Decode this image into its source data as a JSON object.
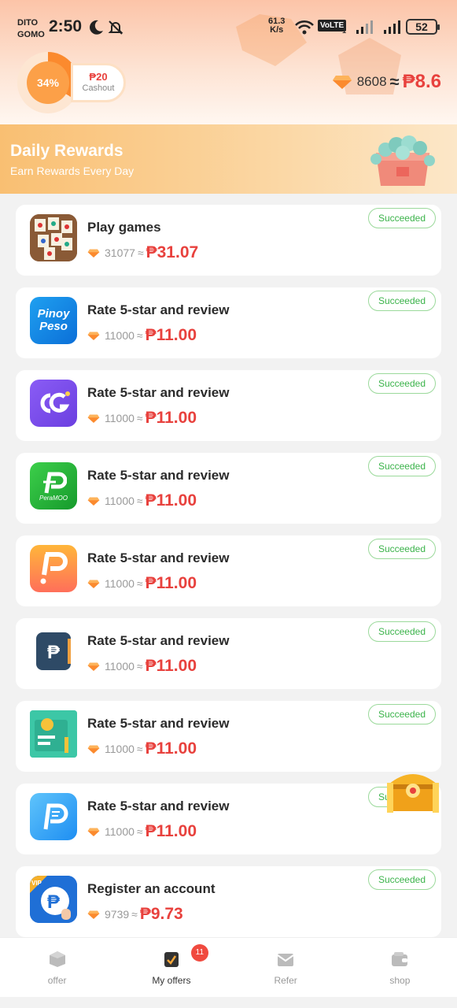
{
  "status_bar": {
    "carrier_line1": "DITO",
    "carrier_line2": "GOMO",
    "time": "2:50",
    "speed_value": "61.3",
    "speed_unit": "K/s",
    "volte": "VoLTE",
    "sim": "1",
    "battery": "52"
  },
  "header": {
    "progress_percent_text": "34%",
    "progress_fraction": 0.34,
    "cashout_amount": "₱20",
    "cashout_label": "Cashout",
    "coin_balance": "8608",
    "approx": "≈",
    "peso_balance": "₱8.6"
  },
  "banner": {
    "title": "Daily Rewards",
    "subtitle": "Earn Rewards Every Day"
  },
  "offers": [
    {
      "title": "Play games",
      "points": "31077",
      "approx": "≈",
      "cash": "₱31.07",
      "status": "Succeeded",
      "icon": "mahjong-game-icon"
    },
    {
      "title": "Rate 5-star and review",
      "points": "11000",
      "approx": "≈",
      "cash": "₱11.00",
      "status": "Succeeded",
      "icon": "pinoy-peso-icon",
      "icon_text": "Pinoy Peso"
    },
    {
      "title": "Rate 5-star and review",
      "points": "11000",
      "approx": "≈",
      "cash": "₱11.00",
      "status": "Succeeded",
      "icon": "cg-app-icon"
    },
    {
      "title": "Rate 5-star and review",
      "points": "11000",
      "approx": "≈",
      "cash": "₱11.00",
      "status": "Succeeded",
      "icon": "peramoo-icon",
      "icon_text": "PeraMOO"
    },
    {
      "title": "Rate 5-star and review",
      "points": "11000",
      "approx": "≈",
      "cash": "₱11.00",
      "status": "Succeeded",
      "icon": "orange-p-app-icon"
    },
    {
      "title": "Rate 5-star and review",
      "points": "11000",
      "approx": "≈",
      "cash": "₱11.00",
      "status": "Succeeded",
      "icon": "peso-wallet-icon"
    },
    {
      "title": "Rate 5-star and review",
      "points": "11000",
      "approx": "≈",
      "cash": "₱11.00",
      "status": "Succeeded",
      "icon": "green-card-app-icon"
    },
    {
      "title": "Rate 5-star and review",
      "points": "11000",
      "approx": "≈",
      "cash": "₱11.00",
      "status": "Succeeded",
      "icon": "blue-p-app-icon"
    },
    {
      "title": "Register an account",
      "points": "9739",
      "approx": "≈",
      "cash": "₱9.73",
      "status": "Succeeded",
      "icon": "vip-peso-icon"
    }
  ],
  "bottom_nav": {
    "items": [
      {
        "label": "offer",
        "icon": "box-icon"
      },
      {
        "label": "My offers",
        "icon": "clipboard-check-icon",
        "badge": "11"
      },
      {
        "label": "Refer",
        "icon": "envelope-icon"
      },
      {
        "label": "shop",
        "icon": "wallet-icon"
      }
    ]
  },
  "colors": {
    "accent_red": "#e8413d",
    "success_green": "#3bb34a",
    "banner_orange": "#f9bf72",
    "progress_orange": "#fca048"
  }
}
